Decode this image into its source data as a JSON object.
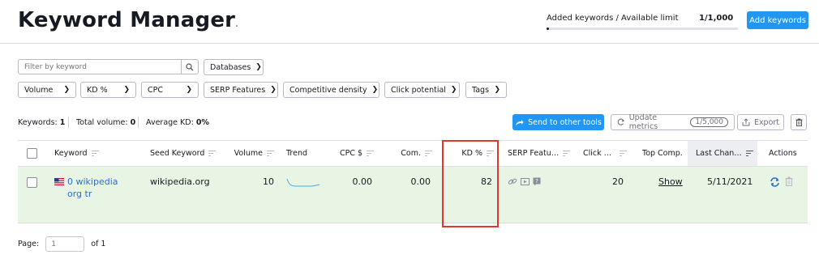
{
  "header": {
    "title": "Keyword Manager",
    "limit_label": "Added keywords / Available limit",
    "limit_count": "1/1,000",
    "limit_fraction": 0.001,
    "add_button": "Add keywords"
  },
  "filters": {
    "search_placeholder": "Filter by keyword",
    "databases": "Databases",
    "dropdowns": [
      "Volume",
      "KD %",
      "CPC",
      "SERP Features",
      "Competitive density",
      "Click potential",
      "Tags"
    ]
  },
  "summary": {
    "keywords_label": "Keywords:",
    "keywords_value": "1",
    "volume_label": "Total volume:",
    "volume_value": "0",
    "kd_label": "Average KD:",
    "kd_value": "0%"
  },
  "toolbar": {
    "send_label": "Send to other tools",
    "update_label": "Update metrics",
    "update_badge": "1/5,000",
    "export_label": "Export"
  },
  "table": {
    "columns": [
      "Keyword",
      "Seed Keyword",
      "Volume",
      "Trend",
      "CPC $",
      "Com.",
      "KD %",
      "SERP Featu…",
      "Click …",
      "Top Comp.",
      "Last Chan…",
      "Actions"
    ],
    "row": {
      "keyword": "0 wikipedia org tr",
      "seed": "wikipedia.org",
      "volume": "10",
      "cpc": "0.00",
      "com": "0.00",
      "kd": "82",
      "click": "20",
      "top_comp": "Show",
      "last_change": "5/11/2021"
    }
  },
  "pager": {
    "label": "Page:",
    "placeholder": "1",
    "of": "of 1"
  },
  "colors": {
    "accent": "#2196f3",
    "row_highlight": "#e8f5e4",
    "highlight_box": "#e0392c",
    "link": "#2a6fcf"
  }
}
